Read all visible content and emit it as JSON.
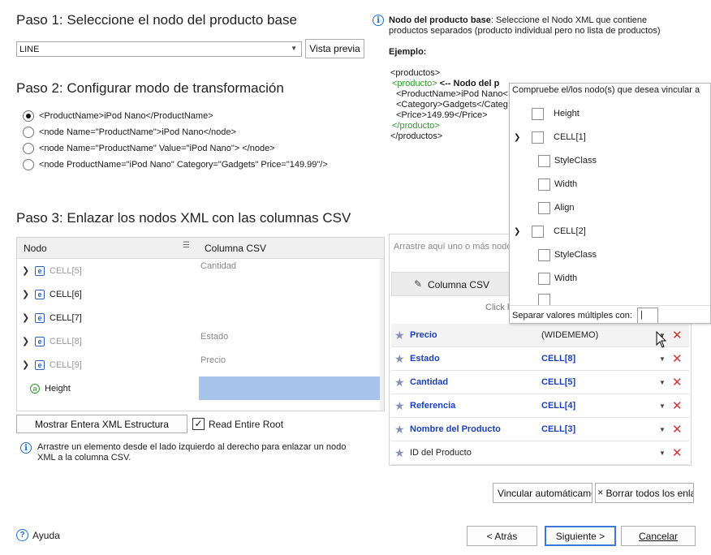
{
  "step1": {
    "title": "Paso 1: Seleccione el nodo del producto base",
    "combo_value": "LINE",
    "preview_button": "Vista previa"
  },
  "info": {
    "heading": "Nodo del producto base",
    "text_line1": ": Seleccione el Nodo XML que contiene",
    "text_line2": "productos separados (producto individual pero no lista de productos)",
    "example_label": "Ejemplo:",
    "xml": {
      "l1": "<productos>",
      "l2a": "<producto>",
      "l2b": " <-- Nodo del p",
      "l3": "<ProductName>iPod Nano<",
      "l4": "<Category>Gadgets</Categ",
      "l5": "<Price>149.99</Price>",
      "l6": "</producto>",
      "l7": "</productos>"
    }
  },
  "step2": {
    "title": "Paso 2: Configurar modo de transformación",
    "options": [
      {
        "label": "<ProductName>iPod Nano</ProductName>",
        "selected": true
      },
      {
        "label": "<node Name=\"ProductName\">iPod Nano</node>",
        "selected": false
      },
      {
        "label": "<node Name=\"ProductName\" Value=\"iPod Nano\"> </node>",
        "selected": false
      },
      {
        "label": "<node ProductName=\"iPod Nano\" Category=\"Gadgets\" Price=\"149.99\"/>",
        "selected": false
      }
    ]
  },
  "step3": {
    "title": "Paso 3: Enlazar los nodos XML con las columnas CSV",
    "col_node": "Nodo",
    "col_csv": "Columna CSV",
    "tree": [
      {
        "label": "CELL[5]",
        "csv": "Cantidad",
        "dim": true
      },
      {
        "label": "CELL[6]",
        "csv": "",
        "dim": false
      },
      {
        "label": "CELL[7]",
        "csv": "",
        "dim": false
      },
      {
        "label": "CELL[8]",
        "csv": "Estado",
        "dim": true
      },
      {
        "label": "CELL[9]",
        "csv": "Precio",
        "dim": true
      },
      {
        "label": "Height",
        "csv": "",
        "dim": false
      }
    ],
    "show_all_button": "Mostrar Entera XML Estructura",
    "read_entire_root": "Read Entire Root",
    "hint": "Arrastre un elemento desde el lado izquierdo al derecho para enlazar un nodo",
    "hint2": "XML a la columna CSV."
  },
  "right": {
    "drop_hint": "Arrastre aquí uno o más nodo",
    "csv_header": "Columna CSV",
    "click_hint": "Click h",
    "rows": [
      {
        "name": "Precio",
        "value": "(WIDEMEMO)",
        "bold_value": false
      },
      {
        "name": "Estado",
        "value": "CELL[8]",
        "bold_value": true
      },
      {
        "name": "Cantidad",
        "value": "CELL[5]",
        "bold_value": true
      },
      {
        "name": "Referencia",
        "value": "CELL[4]",
        "bold_value": true
      },
      {
        "name": "Nombre del Producto",
        "value": "CELL[3]",
        "bold_value": true
      },
      {
        "name": "ID del Producto",
        "value": "",
        "bold_value": false
      }
    ],
    "auto_link": "Vincular automáticame",
    "clear_all": "Borrar todos los enlac"
  },
  "popup": {
    "title": "Compruebe el/los nodo(s) que desea vincular a",
    "items": [
      {
        "label": "Height",
        "level": 0,
        "expand": false
      },
      {
        "label": "CELL[1]",
        "level": 0,
        "expand": true
      },
      {
        "label": "StyleClass",
        "level": 1,
        "expand": false
      },
      {
        "label": "Width",
        "level": 1,
        "expand": false
      },
      {
        "label": "Align",
        "level": 1,
        "expand": false
      },
      {
        "label": "CELL[2]",
        "level": 0,
        "expand": true
      },
      {
        "label": "StyleClass",
        "level": 1,
        "expand": false
      },
      {
        "label": "Width",
        "level": 1,
        "expand": false
      },
      {
        "label": "",
        "level": 1,
        "expand": false
      }
    ],
    "separator_label": "Separar valores múltiples con:",
    "separator_value": "|"
  },
  "footer": {
    "help": "Ayuda",
    "back": "< Atrás",
    "next": "Siguiente >",
    "cancel": "Cancelar"
  }
}
